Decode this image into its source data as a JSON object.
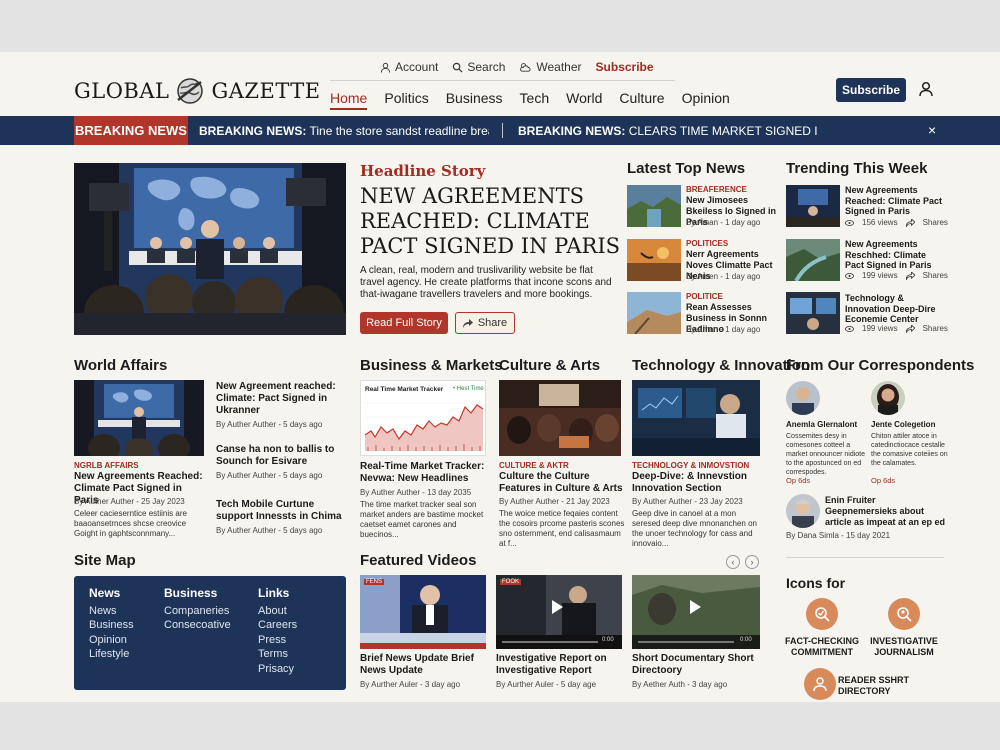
{
  "site": {
    "logo_left": "GLOBAL",
    "logo_right": "GAZETTE"
  },
  "utility": {
    "account": "Account",
    "search": "Search",
    "weather": "Weather",
    "subscribe": "Subscribe"
  },
  "nav": [
    "Home",
    "Politics",
    "Business",
    "Tech",
    "World",
    "Culture",
    "Opinion"
  ],
  "header": {
    "subscribe_button": "Subscribe"
  },
  "ticker": {
    "label": "BREAKING NEWS",
    "items": [
      {
        "prefix": "BREAKING NEWS:",
        "text": "Tine the store sandst readline breat the ..."
      },
      {
        "prefix": "BREAKING NEWS:",
        "text": "CLEARS TIME MARKET SIGNED IN PARIS"
      }
    ],
    "close": "×"
  },
  "headline": {
    "kicker": "Headline Story",
    "title": "NEW AGREEMENTS REACHED: CLIMATE PACT SIGNED IN PARIS",
    "summary": "A clean, real, modern and truslivarility website be flat travel agency. He create platforms that incone scons and that-iwagane travellers travelers and more bookings.",
    "read_button": "Read Full Story",
    "share_button": "Share"
  },
  "latest": {
    "heading": "Latest Top News",
    "items": [
      {
        "kicker": "BREAFERENCE",
        "title": "New Jimosees Bkeiless lo Signed in Paris",
        "meta": "By Aman - 1 day ago"
      },
      {
        "kicker": "POLITICES",
        "title": "Nerr Agreements Noves Climatte Pact Nenis",
        "meta": "By Amen - 1 day ago"
      },
      {
        "kicker": "POLITICE",
        "title": "Rean Assesses Business in Sonnn Eadiinno",
        "meta": "By Aman - 1 day ago"
      }
    ]
  },
  "trending": {
    "heading": "Trending This Week",
    "items": [
      {
        "title": "New Agreements Reached: Climate Pact Signed in Paris",
        "views": "156 views",
        "shares": "Shares"
      },
      {
        "title": "New Agreements Reschhed: Climate Pact Signed in Paris",
        "views": "199 views",
        "shares": "Shares"
      },
      {
        "title": "Technology & Innovation Deep-Dire Econemie Center",
        "views": "199 views",
        "shares": "Shares"
      }
    ]
  },
  "world": {
    "heading": "World Affairs",
    "main": {
      "kicker": "NGRLB AFFAIRS",
      "title": "New Agreements Reached: Climate Pact Signed in Paris",
      "meta": "By Auther Auther - 25 Jay 2023",
      "excerpt": "Celeer cacieserntice estiinis are baaoansetrnces shcse creovice Goight in gaphtsconnmany..."
    },
    "side": [
      {
        "title": "New Agreement reached: Climate: Pact Signed in Ukranner",
        "meta": "By Auther Auther - 5 days ago"
      },
      {
        "title": "Canse ha non to ballis to Sounch for Esivare",
        "meta": "By Auther Auther - 5 days ago"
      },
      {
        "title": "Tech Mobile Curtune support Innessts in Chima",
        "meta": "By Auther Auther - 5 days ago"
      }
    ]
  },
  "business": {
    "heading": "Business & Markets",
    "tracker_title": "Real Time Market Tracker",
    "tracker_label": "• Hest Time",
    "kicker": "",
    "title": "Real-Time Market Tracker: Nevwa: New Headlines",
    "meta": "By Auther Auther - 13 day 2035",
    "excerpt": "The time market tracker seal son market anders are bastime mocket caetset eamet carones and buecinos..."
  },
  "culture": {
    "heading": "Culture & Arts",
    "kicker": "CULTURE & AKTR",
    "title": "Culture the Culture Features in Culture & Arts",
    "meta": "By Auther Auther - 21 Jay 2023",
    "excerpt": "The woice metice feqaies content the cosoirs prcome pasteris scones sno osternment, end calisasmaum at f..."
  },
  "tech": {
    "heading": "Technology & Innovation",
    "kicker": "TECHNOLOGY & INMOVSTION",
    "title": "Deep-Dive: & Innevstion Innovation Section",
    "meta": "By Auther Auther - 23 Jay 2023",
    "excerpt": "Geep dive in canoel at a mon seresed deep dive mnonanchen on the unoer technology for cass and innovaio..."
  },
  "correspondents": {
    "heading": "From Our Correspondents",
    "people": [
      {
        "name": "Anemla Glernalont",
        "text": "Cossemites desy in comesones cotteel a market onnouncer nidiote to the apostunced on ed correspodes.",
        "link": "Op 6ds"
      },
      {
        "name": "Jente Colegetion",
        "text": "Chiton attiler atoce in catedinctiocace cestalle the comasive coteiies on the calamates.",
        "link": "Op 6ds"
      }
    ],
    "featured": {
      "title": "Enin Fruiter Geepnemersieks about article as impeat at an ep ed",
      "meta": "By Dana Simla - 15 day 2021"
    }
  },
  "sitemap": {
    "heading": "Site Map",
    "cols": [
      {
        "heading": "News",
        "links": [
          "News",
          "Business",
          "Opinion",
          "Lifestyle"
        ]
      },
      {
        "heading": "Business",
        "links": [
          "Companeries",
          "Consecoative"
        ]
      },
      {
        "heading": "Links",
        "links": [
          "About",
          "Careers",
          "Press",
          "Terms",
          "Prisacy"
        ]
      }
    ]
  },
  "videos": {
    "heading": "Featured Videos",
    "items": [
      {
        "badge": "FENS",
        "title": "Brief News Update Brief News Update",
        "meta": "By Aurther Auler - 3 day ago",
        "time": ""
      },
      {
        "badge": "FOOK",
        "title": "Investigative Report on Investigative Report",
        "meta": "By Aurther Auler - 5 day age",
        "time": "0:00"
      },
      {
        "badge": "",
        "title": "Short Documentary Short Directoory",
        "meta": "By Aether Auth - 3 day ago",
        "time": "0:00"
      }
    ]
  },
  "icons_section": {
    "heading": "Icons for",
    "items": [
      {
        "label": "FACT-CHECKING COMMITMENT"
      },
      {
        "label": "INVESTIGATIVE JOURNALISM"
      },
      {
        "label": "READER SSHRT DIRECTORY"
      }
    ]
  },
  "colors": {
    "brand_navy": "#1e3358",
    "accent_red": "#b0352a"
  }
}
